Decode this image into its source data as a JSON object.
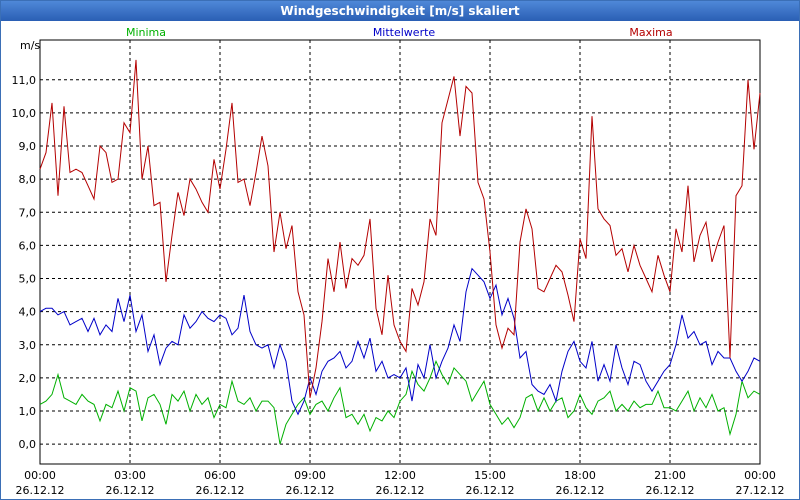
{
  "window": {
    "title": "Windgeschwindigkeit [m/s] skaliert"
  },
  "chart_data": {
    "type": "line",
    "ylabel": "m/s",
    "ylim": [
      -0.6,
      12.2
    ],
    "yticks": [
      "0,0",
      "1,0",
      "2,0",
      "3,0",
      "4,0",
      "5,0",
      "6,0",
      "7,0",
      "8,0",
      "9,0",
      "10,0",
      "11,0"
    ],
    "ytick_values": [
      0,
      1,
      2,
      3,
      4,
      5,
      6,
      7,
      8,
      9,
      10,
      11
    ],
    "xlim": [
      0,
      24
    ],
    "xticks": [
      {
        "time": "00:00",
        "date": "26.12.12",
        "hour": 0
      },
      {
        "time": "03:00",
        "date": "26.12.12",
        "hour": 3
      },
      {
        "time": "06:00",
        "date": "26.12.12",
        "hour": 6
      },
      {
        "time": "09:00",
        "date": "26.12.12",
        "hour": 9
      },
      {
        "time": "12:00",
        "date": "26.12.12",
        "hour": 12
      },
      {
        "time": "15:00",
        "date": "26.12.12",
        "hour": 15
      },
      {
        "time": "18:00",
        "date": "26.12.12",
        "hour": 18
      },
      {
        "time": "21:00",
        "date": "26.12.12",
        "hour": 21
      },
      {
        "time": "00:00",
        "date": "27.12.12",
        "hour": 24
      }
    ],
    "grid": true,
    "legend_position": "top",
    "series": [
      {
        "name": "Minima",
        "color": "#00b000",
        "x": [
          0,
          0.2,
          0.4,
          0.6,
          0.8,
          1.0,
          1.2,
          1.4,
          1.6,
          1.8,
          2.0,
          2.2,
          2.4,
          2.6,
          2.8,
          3.0,
          3.2,
          3.4,
          3.6,
          3.8,
          4.0,
          4.2,
          4.4,
          4.6,
          4.8,
          5.0,
          5.2,
          5.4,
          5.6,
          5.8,
          6.0,
          6.2,
          6.4,
          6.6,
          6.8,
          7.0,
          7.2,
          7.4,
          7.6,
          7.8,
          8.0,
          8.2,
          8.4,
          8.6,
          8.8,
          9.0,
          9.2,
          9.4,
          9.6,
          9.8,
          10.0,
          10.2,
          10.4,
          10.6,
          10.8,
          11.0,
          11.2,
          11.4,
          11.6,
          11.8,
          12.0,
          12.2,
          12.4,
          12.6,
          12.8,
          13.0,
          13.2,
          13.4,
          13.6,
          13.8,
          14.0,
          14.2,
          14.4,
          14.6,
          14.8,
          15.0,
          15.2,
          15.4,
          15.6,
          15.8,
          16.0,
          16.2,
          16.4,
          16.6,
          16.8,
          17.0,
          17.2,
          17.4,
          17.6,
          17.8,
          18.0,
          18.2,
          18.4,
          18.6,
          18.8,
          19.0,
          19.2,
          19.4,
          19.6,
          19.8,
          20.0,
          20.2,
          20.4,
          20.6,
          20.8,
          21.0,
          21.2,
          21.4,
          21.6,
          21.8,
          22.0,
          22.2,
          22.4,
          22.6,
          22.8,
          23.0,
          23.2,
          23.4,
          23.6,
          23.8,
          24.0
        ],
        "y": [
          1.2,
          1.3,
          1.5,
          2.1,
          1.4,
          1.3,
          1.2,
          1.5,
          1.3,
          1.2,
          0.7,
          1.2,
          1.1,
          1.6,
          1.0,
          1.7,
          1.6,
          0.7,
          1.4,
          1.5,
          1.2,
          0.6,
          1.5,
          1.3,
          1.6,
          1.0,
          1.5,
          1.2,
          1.4,
          0.8,
          1.2,
          1.1,
          1.9,
          1.3,
          1.2,
          1.4,
          1.0,
          1.3,
          1.3,
          1.1,
          0.0,
          0.6,
          0.9,
          1.2,
          1.4,
          0.9,
          1.2,
          1.3,
          1.0,
          1.4,
          1.7,
          0.8,
          0.9,
          0.6,
          0.9,
          0.4,
          0.8,
          0.7,
          1.0,
          0.8,
          1.3,
          1.5,
          2.2,
          1.8,
          1.6,
          2.0,
          2.5,
          2.1,
          1.8,
          2.3,
          2.1,
          1.9,
          1.3,
          1.6,
          1.9,
          1.2,
          0.9,
          0.6,
          0.8,
          0.5,
          0.8,
          1.4,
          1.5,
          1.0,
          1.4,
          1.0,
          1.3,
          1.4,
          0.8,
          1.0,
          1.5,
          1.1,
          0.9,
          1.3,
          1.4,
          1.6,
          1.0,
          1.2,
          1.0,
          1.3,
          1.1,
          1.2,
          1.2,
          1.6,
          1.1,
          1.1,
          1.0,
          1.3,
          1.6,
          1.0,
          1.4,
          1.1,
          1.5,
          1.0,
          1.1,
          0.3,
          0.9,
          1.9,
          1.4,
          1.6,
          1.5
        ]
      },
      {
        "name": "Mittelwerte",
        "color": "#0000c8",
        "x": [
          0,
          0.2,
          0.4,
          0.6,
          0.8,
          1.0,
          1.2,
          1.4,
          1.6,
          1.8,
          2.0,
          2.2,
          2.4,
          2.6,
          2.8,
          3.0,
          3.2,
          3.4,
          3.6,
          3.8,
          4.0,
          4.2,
          4.4,
          4.6,
          4.8,
          5.0,
          5.2,
          5.4,
          5.6,
          5.8,
          6.0,
          6.2,
          6.4,
          6.6,
          6.8,
          7.0,
          7.2,
          7.4,
          7.6,
          7.8,
          8.0,
          8.2,
          8.4,
          8.6,
          8.8,
          9.0,
          9.2,
          9.4,
          9.6,
          9.8,
          10.0,
          10.2,
          10.4,
          10.6,
          10.8,
          11.0,
          11.2,
          11.4,
          11.6,
          11.8,
          12.0,
          12.2,
          12.4,
          12.6,
          12.8,
          13.0,
          13.2,
          13.4,
          13.6,
          13.8,
          14.0,
          14.2,
          14.4,
          14.6,
          14.8,
          15.0,
          15.2,
          15.4,
          15.6,
          15.8,
          16.0,
          16.2,
          16.4,
          16.6,
          16.8,
          17.0,
          17.2,
          17.4,
          17.6,
          17.8,
          18.0,
          18.2,
          18.4,
          18.6,
          18.8,
          19.0,
          19.2,
          19.4,
          19.6,
          19.8,
          20.0,
          20.2,
          20.4,
          20.6,
          20.8,
          21.0,
          21.2,
          21.4,
          21.6,
          21.8,
          22.0,
          22.2,
          22.4,
          22.6,
          22.8,
          23.0,
          23.2,
          23.4,
          23.6,
          23.8,
          24.0
        ],
        "y": [
          4.0,
          4.1,
          4.1,
          3.9,
          4.0,
          3.6,
          3.7,
          3.8,
          3.4,
          3.8,
          3.3,
          3.6,
          3.4,
          4.4,
          3.7,
          4.5,
          3.4,
          3.9,
          2.8,
          3.3,
          2.4,
          2.9,
          3.1,
          3.0,
          3.9,
          3.5,
          3.7,
          4.0,
          3.8,
          3.7,
          3.9,
          3.8,
          3.3,
          3.5,
          4.5,
          3.4,
          3.0,
          2.9,
          3.0,
          2.3,
          3.0,
          2.5,
          1.3,
          0.9,
          1.3,
          2.0,
          1.5,
          2.2,
          2.5,
          2.6,
          2.8,
          2.3,
          2.5,
          3.1,
          2.6,
          3.2,
          2.2,
          2.5,
          2.0,
          2.1,
          2.0,
          2.3,
          1.3,
          2.4,
          2.0,
          3.0,
          2.0,
          2.5,
          2.9,
          3.6,
          3.1,
          4.6,
          5.3,
          5.1,
          4.9,
          4.4,
          4.8,
          3.9,
          4.4,
          3.8,
          2.6,
          2.8,
          1.8,
          1.6,
          1.5,
          1.8,
          1.3,
          2.2,
          2.8,
          3.1,
          2.5,
          2.3,
          3.1,
          1.9,
          2.4,
          1.9,
          3.0,
          2.3,
          1.8,
          2.5,
          2.4,
          1.9,
          1.6,
          1.9,
          2.2,
          2.4,
          3.0,
          3.9,
          3.2,
          3.4,
          3.0,
          3.1,
          2.4,
          2.8,
          2.6,
          2.6,
          2.2,
          1.9,
          2.2,
          2.6,
          2.5
        ]
      },
      {
        "name": "Maxima",
        "color": "#b40000",
        "x": [
          0,
          0.2,
          0.4,
          0.6,
          0.8,
          1.0,
          1.2,
          1.4,
          1.6,
          1.8,
          2.0,
          2.2,
          2.4,
          2.6,
          2.8,
          3.0,
          3.2,
          3.4,
          3.6,
          3.8,
          4.0,
          4.2,
          4.4,
          4.6,
          4.8,
          5.0,
          5.2,
          5.4,
          5.6,
          5.8,
          6.0,
          6.2,
          6.4,
          6.6,
          6.8,
          7.0,
          7.2,
          7.4,
          7.6,
          7.8,
          8.0,
          8.2,
          8.4,
          8.6,
          8.8,
          9.0,
          9.2,
          9.4,
          9.6,
          9.8,
          10.0,
          10.2,
          10.4,
          10.6,
          10.8,
          11.0,
          11.2,
          11.4,
          11.6,
          11.8,
          12.0,
          12.2,
          12.4,
          12.6,
          12.8,
          13.0,
          13.2,
          13.4,
          13.6,
          13.8,
          14.0,
          14.2,
          14.4,
          14.6,
          14.8,
          15.0,
          15.2,
          15.4,
          15.6,
          15.8,
          16.0,
          16.2,
          16.4,
          16.6,
          16.8,
          17.0,
          17.2,
          17.4,
          17.6,
          17.8,
          18.0,
          18.2,
          18.4,
          18.6,
          18.8,
          19.0,
          19.2,
          19.4,
          19.6,
          19.8,
          20.0,
          20.2,
          20.4,
          20.6,
          20.8,
          21.0,
          21.2,
          21.4,
          21.6,
          21.8,
          22.0,
          22.2,
          22.4,
          22.6,
          22.8,
          23.0,
          23.2,
          23.4,
          23.6,
          23.8,
          24.0
        ],
        "y": [
          8.3,
          8.8,
          10.3,
          7.5,
          10.2,
          8.2,
          8.3,
          8.2,
          7.8,
          7.4,
          9.0,
          8.8,
          7.9,
          8.0,
          9.7,
          9.4,
          11.6,
          8.0,
          9.0,
          7.2,
          7.3,
          4.9,
          6.3,
          7.6,
          6.9,
          8.0,
          7.7,
          7.3,
          7.0,
          8.6,
          7.7,
          8.9,
          10.3,
          7.9,
          8.0,
          7.2,
          8.2,
          9.3,
          8.4,
          5.8,
          7.0,
          5.9,
          6.6,
          4.6,
          3.9,
          1.4,
          2.3,
          3.7,
          5.6,
          4.6,
          6.1,
          4.7,
          5.6,
          5.4,
          5.7,
          6.8,
          4.1,
          3.3,
          5.1,
          3.6,
          3.1,
          2.8,
          4.7,
          4.2,
          4.9,
          6.8,
          6.3,
          9.7,
          10.4,
          11.1,
          9.3,
          10.8,
          10.6,
          7.9,
          7.4,
          5.8,
          3.6,
          2.9,
          3.5,
          3.3,
          6.1,
          7.1,
          6.5,
          4.7,
          4.6,
          5.0,
          5.4,
          5.2,
          4.5,
          3.7,
          6.2,
          5.6,
          9.9,
          7.1,
          6.8,
          6.6,
          5.7,
          5.9,
          5.2,
          6.0,
          5.4,
          5.0,
          4.6,
          5.7,
          5.1,
          4.6,
          6.5,
          5.8,
          7.8,
          5.5,
          6.3,
          6.7,
          5.5,
          6.1,
          6.6,
          2.6,
          7.5,
          7.8,
          11.0,
          8.9,
          10.6
        ]
      }
    ]
  }
}
